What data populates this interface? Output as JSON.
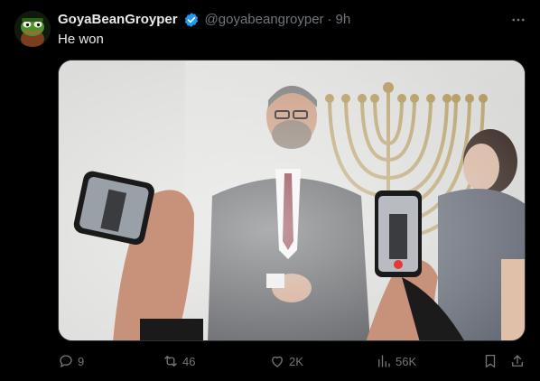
{
  "tweet": {
    "display_name": "GoyaBeanGroyper",
    "handle": "@goyabeangroyper",
    "separator": "·",
    "time": "9h",
    "text": "He won",
    "verified": true,
    "avatar_icon": "frog-avatar-icon",
    "more_icon": "more-options-icon"
  },
  "actions": {
    "reply": {
      "icon": "reply-icon",
      "count": "9"
    },
    "repost": {
      "icon": "repost-icon",
      "count": "46"
    },
    "like": {
      "icon": "heart-icon",
      "count": "2K"
    },
    "views": {
      "icon": "views-icon",
      "count": "56K"
    },
    "bookmark": {
      "icon": "bookmark-icon"
    },
    "share": {
      "icon": "share-icon"
    }
  },
  "colors": {
    "background": "#000000",
    "text": "#e7e9ea",
    "muted": "#71767b",
    "verified": "#1d9bf0"
  }
}
